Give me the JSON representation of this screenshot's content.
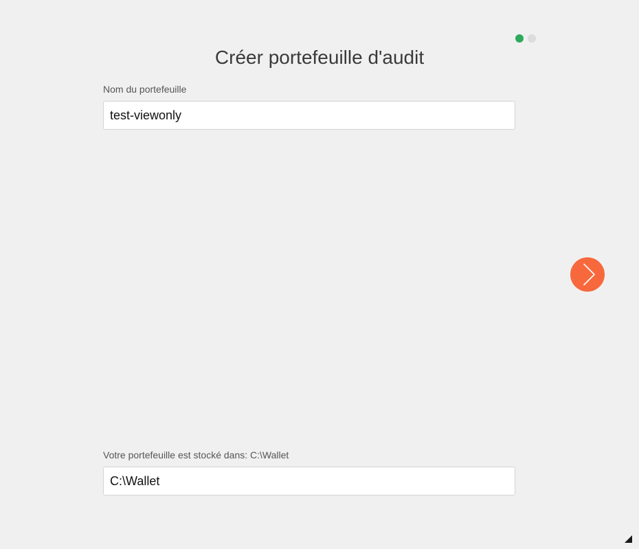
{
  "title": "Créer portefeuille d'audit",
  "pagination": {
    "total": 2,
    "active": 1,
    "active_color": "#2eaa5c",
    "inactive_color": "#dcdcdc"
  },
  "wallet_name": {
    "label": "Nom du portefeuille",
    "value": "test-viewonly"
  },
  "wallet_location": {
    "label": "Votre portefeuille est stocké dans: C:\\Wallet",
    "value": "C:\\Wallet"
  },
  "next_button": {
    "icon": "chevron-right-icon",
    "color": "#f7693d"
  },
  "resize_grip": {
    "icon": "resize-grip-icon"
  }
}
